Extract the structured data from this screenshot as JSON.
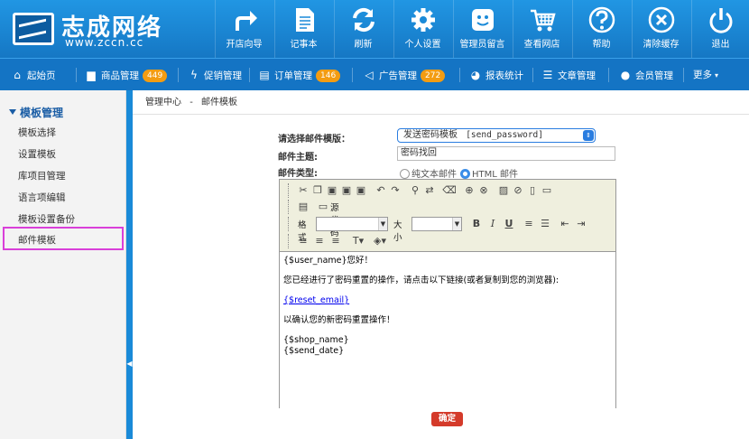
{
  "logo": {
    "name": "志成网络",
    "url": "www.zccn.cc"
  },
  "toolbar": [
    {
      "label": "开店向导",
      "icon": "share-arrow-icon"
    },
    {
      "label": "记事本",
      "icon": "notepad-icon"
    },
    {
      "label": "刷新",
      "icon": "refresh-icon"
    },
    {
      "label": "个人设置",
      "icon": "gear-icon"
    },
    {
      "label": "管理员留言",
      "icon": "smiley-message-icon"
    },
    {
      "label": "查看网店",
      "icon": "cart-icon"
    },
    {
      "label": "帮助",
      "icon": "help-icon"
    },
    {
      "label": "清除缓存",
      "icon": "clear-cache-icon"
    },
    {
      "label": "退出",
      "icon": "power-icon"
    }
  ],
  "nav": [
    {
      "label": "起始页",
      "icon": "home-icon"
    },
    {
      "label": "商品管理",
      "icon": "folder-icon",
      "badge": "449"
    },
    {
      "label": "促销管理",
      "icon": "lightning-icon"
    },
    {
      "label": "订单管理",
      "icon": "order-icon",
      "badge": "146"
    },
    {
      "label": "广告管理",
      "icon": "megaphone-icon",
      "badge": "272"
    },
    {
      "label": "报表统计",
      "icon": "pie-chart-icon"
    },
    {
      "label": "文章管理",
      "icon": "list-icon"
    },
    {
      "label": "会员管理",
      "icon": "user-icon"
    },
    {
      "label": "更多",
      "icon": "chevron-down-icon"
    }
  ],
  "sidebar": {
    "title": "模板管理",
    "items": [
      "模板选择",
      "设置模板",
      "库项目管理",
      "语言项编辑",
      "模板设置备份",
      "邮件模板"
    ]
  },
  "breadcrumb": {
    "home": "管理中心",
    "sep": "-",
    "current": "邮件模板"
  },
  "form": {
    "template_label": "请选择邮件模版：",
    "template_value": "发送密码模板",
    "template_code": "[send_password]",
    "subject_label": "邮件主题:",
    "subject_value": "密码找回",
    "type_label": "邮件类型:",
    "type_plain": "纯文本邮件",
    "type_html": "HTML 邮件",
    "selected_type": "html"
  },
  "editor": {
    "source_label": "源代码",
    "format_label": "格式",
    "size_label": "大小",
    "content": {
      "greeting": "{$user_name}您好！",
      "line1": "您已经进行了密码重置的操作，请点击以下链接(或者复制到您的浏览器):",
      "link": "{$reset_email}",
      "line2": "以确认您的新密码重置操作！",
      "shop": "{$shop_name}",
      "date": "{$send_date}"
    }
  },
  "submit_label": "确定",
  "colors": {
    "topbar": "#1a8ad8",
    "nav": "#1474c4",
    "badge": "#f39c12",
    "submit": "#d43a2a",
    "selection_outline": "#d93fd9"
  }
}
